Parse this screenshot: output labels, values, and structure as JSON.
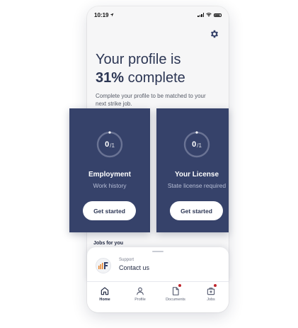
{
  "status_bar": {
    "time": "10:19"
  },
  "profile": {
    "headline_line1": "Your profile is",
    "percent": "31%",
    "percent_suffix": "complete",
    "subtitle": "Complete your profile to be matched to your next strike job."
  },
  "cards": [
    {
      "title": "Employment",
      "subtitle": "Work history",
      "done": "0",
      "total": "/1",
      "progress": 0,
      "button": "Get started"
    },
    {
      "title": "Your License",
      "subtitle": "State license required",
      "done": "0",
      "total": "/1",
      "progress": 0,
      "button": "Get started"
    }
  ],
  "jobs_heading": "Jobs for you",
  "support": {
    "label": "Support",
    "action": "Contact us"
  },
  "tabs": [
    {
      "label": "Home",
      "icon": "home-icon",
      "active": true,
      "badge": false
    },
    {
      "label": "Profile",
      "icon": "person-icon",
      "active": false,
      "badge": false
    },
    {
      "label": "Documents",
      "icon": "document-icon",
      "active": false,
      "badge": true
    },
    {
      "label": "Jobs",
      "icon": "medical-bag-icon",
      "active": false,
      "badge": true
    }
  ],
  "colors": {
    "brand_navy": "#36426a",
    "heading_text": "#2c3654",
    "badge_red": "#c0262d",
    "logo_orange": "#e8842c"
  }
}
